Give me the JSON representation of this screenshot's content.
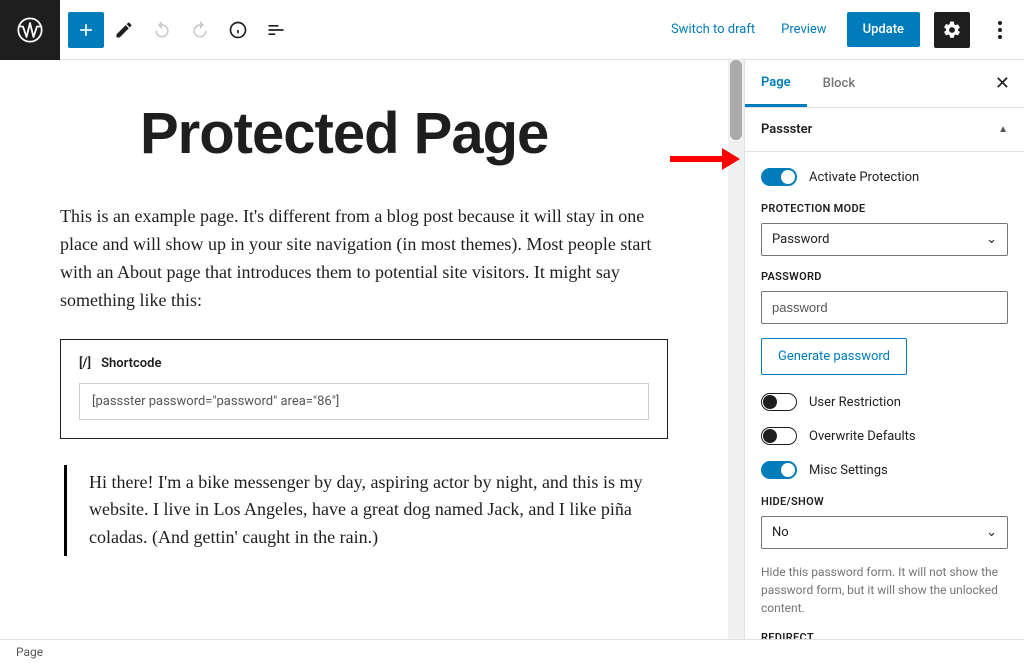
{
  "toolbar": {
    "switch_draft": "Switch to draft",
    "preview": "Preview",
    "update": "Update"
  },
  "sidebar": {
    "tabs": {
      "page": "Page",
      "block": "Block"
    },
    "passster": {
      "title": "Passster",
      "activate_label": "Activate Protection",
      "protection_mode_label": "PROTECTION MODE",
      "protection_mode_value": "Password",
      "password_label": "PASSWORD",
      "password_value": "password",
      "generate_btn": "Generate password",
      "user_restriction": "User Restriction",
      "overwrite_defaults": "Overwrite Defaults",
      "misc_settings": "Misc Settings",
      "hide_show_label": "HIDE/SHOW",
      "hide_show_value": "No",
      "hide_show_help": "Hide this password form. It will not show the password form, but it will show the unlocked content.",
      "redirect_label": "REDIRECT"
    }
  },
  "content": {
    "title": "Protected Page",
    "para1": "This is an example page. It's different from a blog post because it will stay in one place and will show up in your site navigation (in most themes). Most people start with an About page that introduces them to potential site visitors. It might say something like this:",
    "shortcode_label": "Shortcode",
    "shortcode_value": "[passster password=\"password\" area=\"86\"]",
    "quote": "Hi there! I'm a bike messenger by day, aspiring actor by night, and this is my website. I live in Los Angeles, have a great dog named Jack, and I like piña coladas. (And gettin' caught in the rain.)"
  },
  "statusbar": {
    "breadcrumb": "Page"
  }
}
